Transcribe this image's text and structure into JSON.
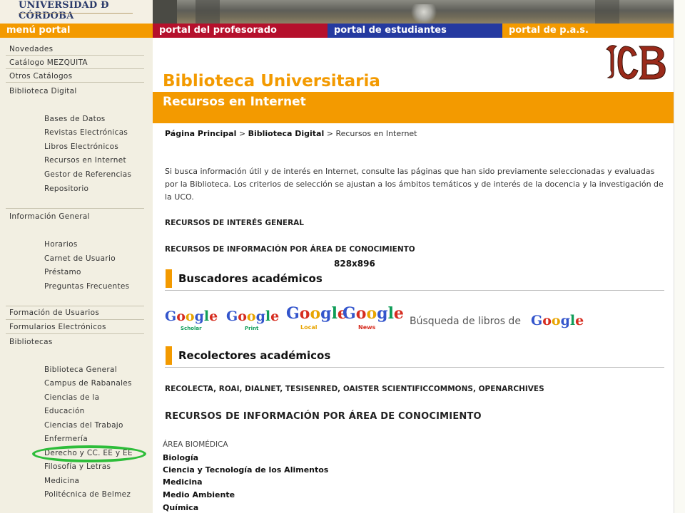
{
  "header": {
    "university_name": "UNIVERSIDAD Ð CÓRDOBA"
  },
  "portal_bar": {
    "menu": "menú portal",
    "profesorado": "portal del profesorado",
    "estudiantes": "portal de estudiantes",
    "pas": "portal de p.a.s."
  },
  "sidebar": {
    "top1": [
      "Novedades",
      "Catálogo MEZQUITA",
      "Otros Catálogos",
      "Biblioteca Digital"
    ],
    "digital_sub": [
      "Bases de Datos",
      "Revistas Electrónicas",
      "Libros Electrónicos",
      "Recursos en Internet",
      "Gestor de Referencias",
      "Repositorio"
    ],
    "info_general": "Información General",
    "info_sub": [
      "Horarios",
      "Carnet de Usuario",
      "Préstamo",
      "Preguntas Frecuentes"
    ],
    "top2": [
      "Formación de Usuarios",
      "Formularios Electrónicos",
      "Bibliotecas"
    ],
    "bibliotecas_sub": [
      "Biblioteca General",
      "Campus de Rabanales",
      "Ciencias de la",
      "Educación",
      "Ciencias del Trabajo",
      "Enfermería",
      "Derecho y CC. EE y EE",
      "Filosofía y Letras",
      "Medicina",
      "Politécnica de Belmez"
    ]
  },
  "main": {
    "title": "Biblioteca Universitaria",
    "section": "Recursos en Internet",
    "breadcrumb": {
      "home": "Página Principal",
      "sep": " > ",
      "digital": "Biblioteca Digital",
      "current": "Recursos en Internet"
    },
    "intro": "Si busca información útil y de interés en Internet, consulte las páginas que han sido previamente seleccionadas y evaluadas por la Biblioteca. Los criterios de selección se ajustan a los ámbitos temáticos y de interés de la docencia y la investigación de la UCO.",
    "link_general": "RECURSOS DE INTERÉS GENERAL",
    "link_area": "RECURSOS DE INFORMACIÓN POR ÁREA DE CONOCIMIENTO",
    "size_label": "828x896",
    "buscadores_heading": "Buscadores académicos",
    "google_products": [
      {
        "name": "Google",
        "sub": "Scholar"
      },
      {
        "name": "Google",
        "sub": "Print"
      },
      {
        "name": "Google",
        "sub": "Local"
      },
      {
        "name": "Google",
        "sub": "News"
      }
    ],
    "google_books_text": "Búsqueda de libros de",
    "google_books_brand": "Google",
    "recolectores_heading": "Recolectores académicos",
    "recolectores_list": "RECOLECTA, ROAI, DIALNET, TESISENRED, OAISTER SCIENTIFICCOMMONS, OPENARCHIVES",
    "area_section_title": "RECURSOS DE INFORMACIÓN POR ÁREA DE CONOCIMIENTO",
    "area_name": "ÁREA BIOMÉDICA",
    "subjects": [
      "Biología",
      "Ciencia y Tecnología de los Alimentos",
      "Medicina",
      "Medio Ambiente",
      "Química"
    ]
  },
  "colors": {
    "accent_orange": "#f39a00",
    "portal_red": "#b5102c",
    "portal_blue": "#253aa0",
    "highlight_green": "#2ebd3a"
  },
  "icons": [
    "uco-logo",
    "biblioteca-bub-logo",
    "google-scholar-logo",
    "google-print-logo",
    "google-local-logo",
    "google-news-logo",
    "google-books-logo"
  ]
}
